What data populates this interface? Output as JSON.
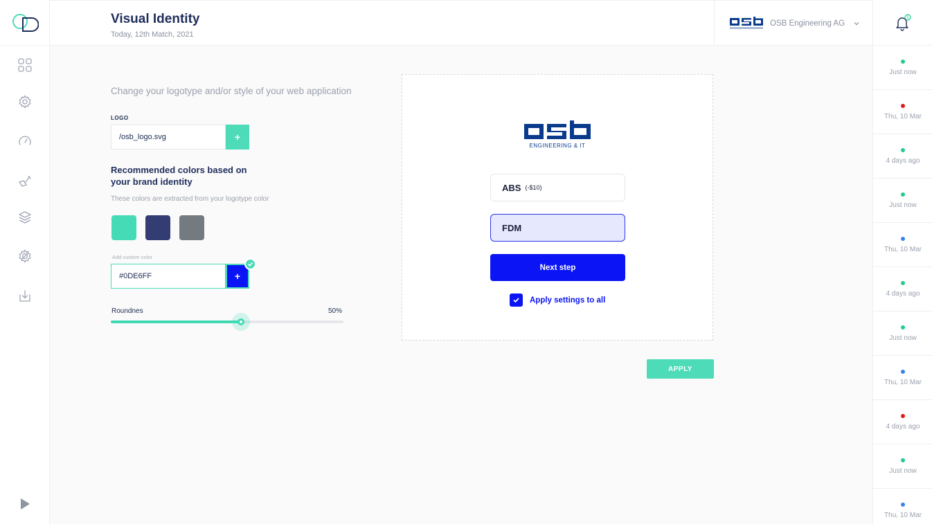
{
  "header": {
    "title": "Visual Identity",
    "date": "Today, 12th Match, 2021",
    "company": "OSB Engineering AG",
    "bell_badge": "5"
  },
  "sidebar": {
    "items": [
      "dashboard-icon",
      "settings-gear-icon",
      "speedometer-icon",
      "tool-icon",
      "layers-icon",
      "settings-cog-icon",
      "download-icon"
    ],
    "play": "play-icon"
  },
  "brand_logo": {
    "wordmark": "osb",
    "tagline": "ENGINEERING & IT"
  },
  "form": {
    "subtitle": "Change your logotype and/or style of your web application",
    "logo_label": "LOGO",
    "logo_value": "/osb_logo.svg",
    "add_symbol": "+",
    "rec_title": "Recommended colors based on your brand identity",
    "rec_desc": "These colors are extracted from your logotype color",
    "swatches": [
      "#45DBB6",
      "#333D74",
      "#737A80"
    ],
    "custom_label": "Add custom color",
    "custom_value": "#0DE6FF",
    "roundness_label": "Roundnes",
    "roundness_value": "50%",
    "roundness_fraction": 0.56
  },
  "preview": {
    "option1_main": "ABS",
    "option1_sub": "(-$10)",
    "option2_main": "FDM",
    "next_step": "Next step",
    "apply_all": "Apply settings to all"
  },
  "apply_button": "APPLY",
  "notifications": [
    {
      "time": "Just now",
      "color": "#1fcf8a"
    },
    {
      "time": "Thu, 10 Mar",
      "color": "#e01b1b"
    },
    {
      "time": "4 days ago",
      "color": "#1fcf8a"
    },
    {
      "time": "Just now",
      "color": "#1fcf8a"
    },
    {
      "time": "Thu, 10 Mar",
      "color": "#3b82f0"
    },
    {
      "time": "4 days ago",
      "color": "#1fcf8a"
    },
    {
      "time": "Just now",
      "color": "#1fcf8a"
    },
    {
      "time": "Thu, 10 Mar",
      "color": "#3b82f0"
    },
    {
      "time": "4 days ago",
      "color": "#e01b1b"
    },
    {
      "time": "Just now",
      "color": "#1fcf8a"
    },
    {
      "time": "Thu, 10 Mar",
      "color": "#3b82f0"
    }
  ]
}
